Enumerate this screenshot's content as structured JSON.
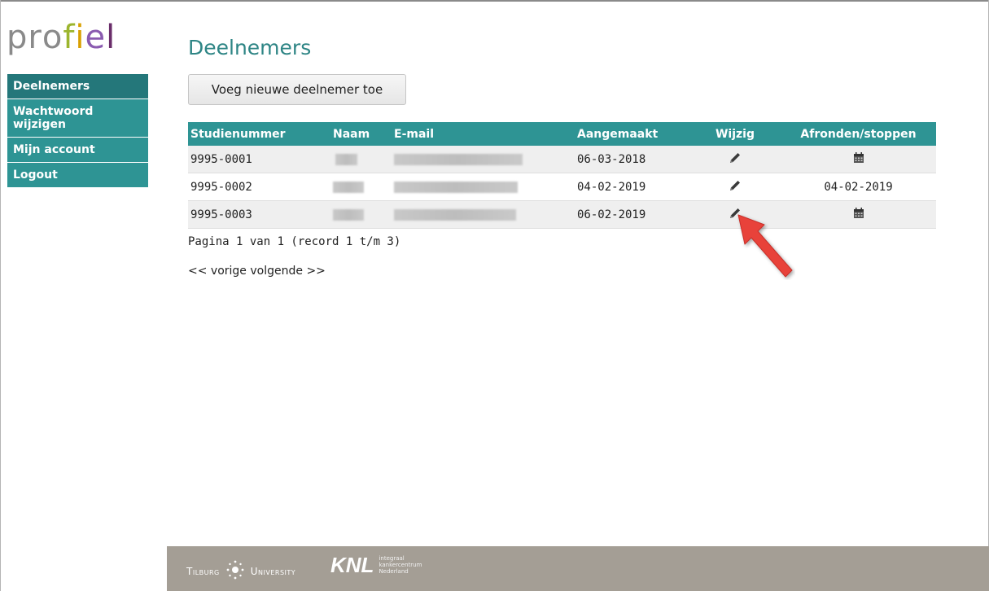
{
  "logo": {
    "letters": [
      "p",
      "r",
      "o",
      "f",
      "i",
      "e",
      "l"
    ],
    "colors": [
      "#8a8a8a",
      "#8a8a8a",
      "#8a8a8a",
      "#9cb52e",
      "#d9a000",
      "#8a5bb0",
      "#6a2d6a"
    ]
  },
  "sidebar": {
    "items": [
      {
        "label": "Deelnemers",
        "active": true
      },
      {
        "label": "Wachtwoord wijzigen",
        "active": false
      },
      {
        "label": "Mijn account",
        "active": false
      },
      {
        "label": "Logout",
        "active": false
      }
    ]
  },
  "main": {
    "title": "Deelnemers",
    "add_button": "Voeg nieuwe deelnemer toe",
    "table": {
      "headers": [
        "Studienummer",
        "Naam",
        "E-mail",
        "Aangemaakt",
        "Wijzig",
        "Afronden/stoppen"
      ],
      "rows": [
        {
          "studienummer": "9995-0001",
          "naam": "",
          "email": "",
          "aangemaakt": "06-03-2018",
          "afronden": "",
          "afronden_icon": "calendar-icon"
        },
        {
          "studienummer": "9995-0002",
          "naam": "",
          "email": "",
          "aangemaakt": "04-02-2019",
          "afronden": "04-02-2019",
          "afronden_icon": ""
        },
        {
          "studienummer": "9995-0003",
          "naam": "",
          "email": "",
          "aangemaakt": "06-02-2019",
          "afronden": "",
          "afronden_icon": "calendar-icon"
        }
      ],
      "edit_icon": "pencil-icon"
    },
    "pagination": "Pagina 1 van 1 (record 1 t/m 3)",
    "pager": {
      "prev": "<< vorige",
      "next": "volgende >>"
    }
  },
  "footer": {
    "tilburg_left": "Tilburg",
    "tilburg_right": "University",
    "knl": "KNL",
    "knl_sub": [
      "integraal",
      "kankercentrum",
      "Nederland"
    ]
  },
  "colors": {
    "accent": "#2e9494",
    "accent_dark": "#24777a",
    "title": "#2e8585",
    "footer": "#a49e95",
    "arrow": "#e8423a"
  }
}
